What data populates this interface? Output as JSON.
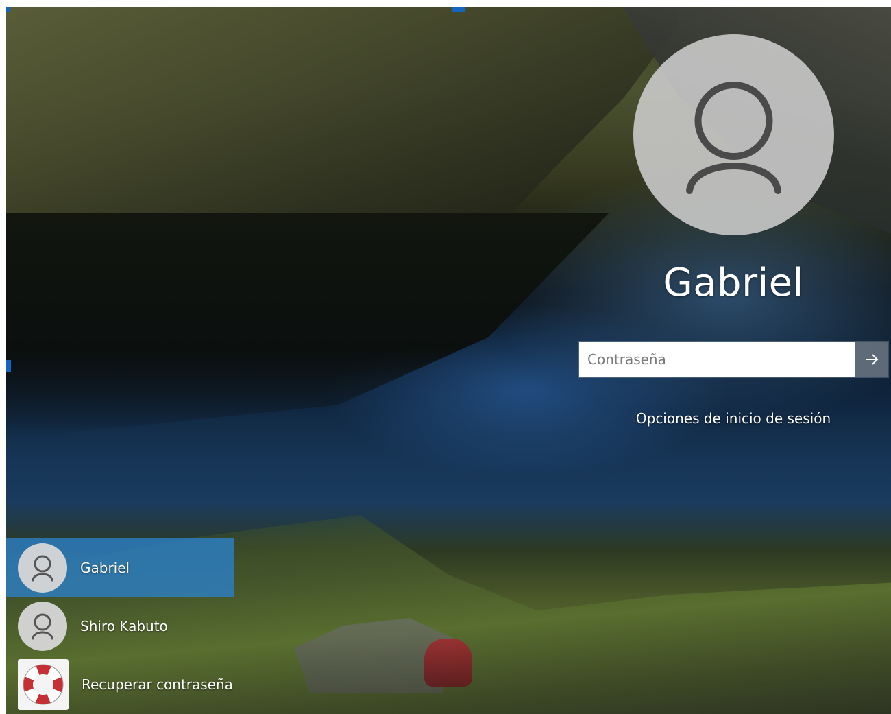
{
  "login": {
    "username": "Gabriel",
    "password_placeholder": "Contraseña",
    "password_value": "",
    "submit_icon": "arrow-right-icon",
    "signin_options_label": "Opciones de inicio de sesión"
  },
  "user_list": {
    "items": [
      {
        "label": "Gabriel",
        "icon": "user-icon",
        "selected": true
      },
      {
        "label": "Shiro Kabuto",
        "icon": "user-icon",
        "selected": false
      },
      {
        "label": "Recuperar contraseña",
        "icon": "lifebuoy-icon",
        "selected": false
      }
    ]
  },
  "colors": {
    "selection_blue": "#2C7FC4",
    "avatar_gray": "#CDCDCD",
    "text_white": "#FFFFFF"
  }
}
